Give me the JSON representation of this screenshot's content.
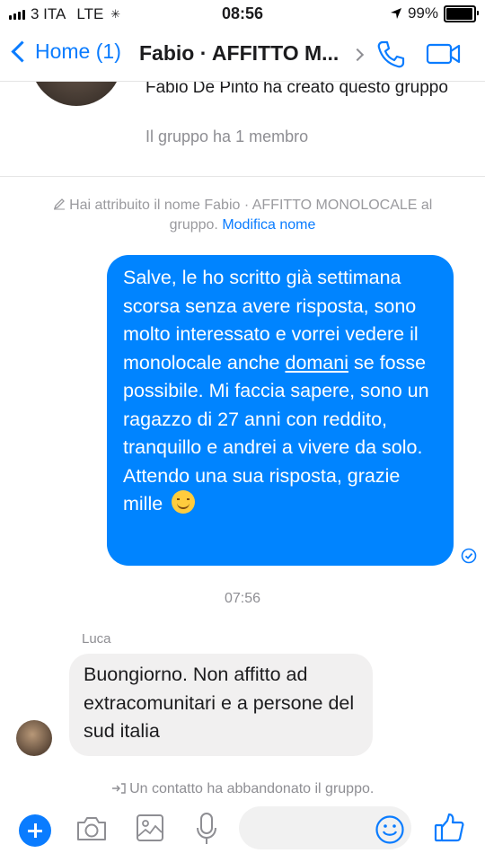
{
  "status_bar": {
    "carrier": "3 ITA",
    "network": "LTE",
    "time": "08:56",
    "battery": "99%"
  },
  "nav": {
    "back_label": "Home (1)",
    "title": "Fabio · AFFITTO M..."
  },
  "chat": {
    "creator_text": "Fabio De Pinto ha creato questo gruppo",
    "members_text": "Il gruppo ha 1 membro",
    "rename_notice": "Hai attribuito il nome Fabio · AFFITTO MONOLOCALE al gruppo.",
    "rename_link": "Modifica nome",
    "outgoing_message": {
      "part1": "Salve, le ho scritto già settimana scorsa senza avere risposta, sono molto interessato e vorrei vedere il monolocale anche ",
      "underlined": "domani",
      "part2": " se fosse possibile. Mi faccia sapere, sono un ragazzo di 27 anni con reddito, tranquillo e andrei a vivere da solo. Attendo una sua risposta, grazie mille "
    },
    "timestamp": "07:56",
    "incoming_sender": "Luca",
    "incoming_message": "Buongiorno. Non affitto ad extracomunitari e a persone del sud italia",
    "left_notice": "Un contatto ha abbandonato il gruppo."
  },
  "composer": {
    "input_value": ""
  },
  "colors": {
    "accent": "#0a7cff",
    "outgoing_bubble": "#0084ff",
    "incoming_bubble": "#f1f0f0"
  }
}
